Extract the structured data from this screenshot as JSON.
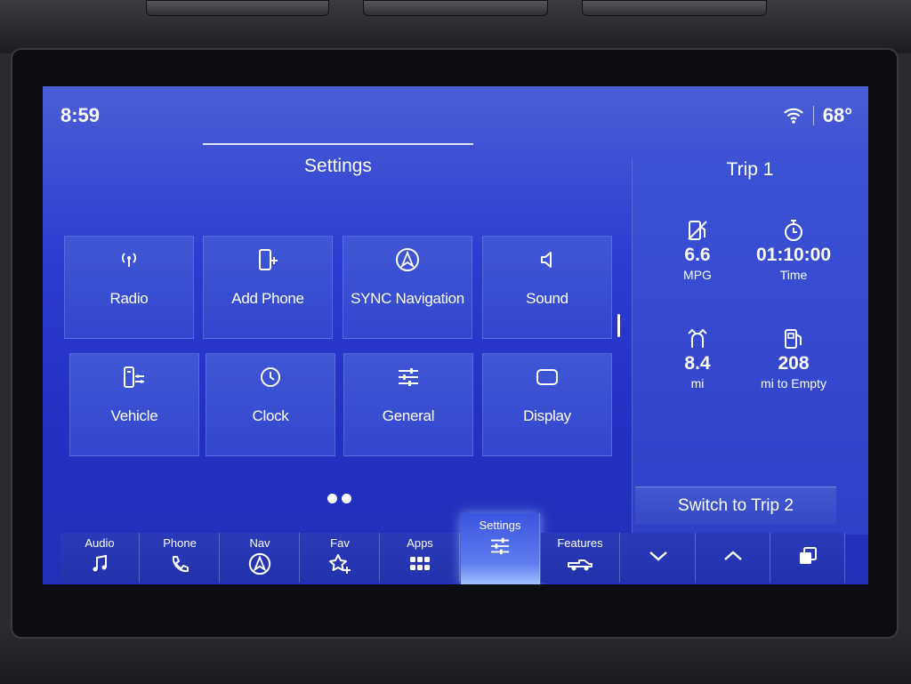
{
  "status": {
    "time": "8:59",
    "temperature": "68°",
    "wifi_icon": "wifi-icon"
  },
  "settings": {
    "title": "Settings",
    "tiles": [
      {
        "label": "Radio",
        "icon": "radio-antenna-icon"
      },
      {
        "label": "Add Phone",
        "icon": "add-phone-icon"
      },
      {
        "label": "SYNC Navigation",
        "icon": "navigation-icon"
      },
      {
        "label": "Sound",
        "icon": "speaker-icon"
      },
      {
        "label": "Vehicle",
        "icon": "vehicle-icon"
      },
      {
        "label": "Clock",
        "icon": "clock-icon"
      },
      {
        "label": "General",
        "icon": "sliders-icon"
      },
      {
        "label": "Display",
        "icon": "display-icon"
      }
    ]
  },
  "trip": {
    "title": "Trip 1",
    "stats": [
      {
        "value": "6.6",
        "unit": "MPG",
        "icon": "fuel-economy-icon"
      },
      {
        "value": "01:10:00",
        "unit": "Time",
        "icon": "stopwatch-icon"
      },
      {
        "value": "8.4",
        "unit": "mi",
        "icon": "distance-icon"
      },
      {
        "value": "208",
        "unit": "mi to Empty",
        "icon": "fuel-pump-icon"
      }
    ],
    "switch_label": "Switch to Trip 2"
  },
  "nav": {
    "items": [
      {
        "label": "Audio",
        "icon": "music-note-icon"
      },
      {
        "label": "Phone",
        "icon": "phone-icon"
      },
      {
        "label": "Nav",
        "icon": "navigation-icon"
      },
      {
        "label": "Fav",
        "icon": "star-plus-icon"
      },
      {
        "label": "Apps",
        "icon": "apps-grid-icon"
      },
      {
        "label": "Settings",
        "icon": "sliders-icon",
        "active": true
      },
      {
        "label": "Features",
        "icon": "truck-icon"
      }
    ],
    "controls": [
      "chevron-down-icon",
      "chevron-up-icon",
      "pages-icon"
    ]
  },
  "colors": {
    "screen_blue": "#2c3bd0",
    "active_glow": "#9fc0ff",
    "text": "#ffffff"
  }
}
